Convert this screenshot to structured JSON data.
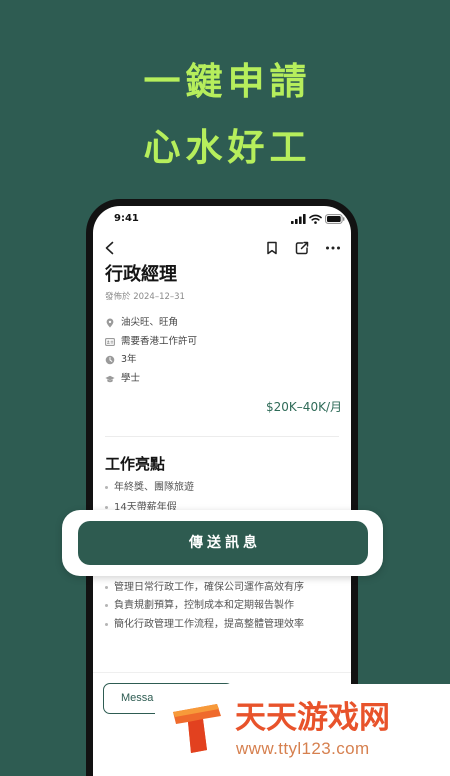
{
  "headline": {
    "line1": "一鍵申請",
    "line2": "心水好工"
  },
  "status_bar": {
    "time": "9:41",
    "icons": [
      "signal-icon",
      "wifi-icon",
      "battery-icon"
    ]
  },
  "nav": {
    "icons": [
      "back-chevron-icon",
      "bookmark-icon",
      "share-icon",
      "more-icon"
    ]
  },
  "job": {
    "title": "行政經理",
    "posted": "發佈於 2024–12–31",
    "details": [
      {
        "icon": "location-pin-icon",
        "text": "油尖旺、旺角"
      },
      {
        "icon": "id-card-icon",
        "text": "需要香港工作許可"
      },
      {
        "icon": "clock-icon",
        "text": "3年"
      },
      {
        "icon": "graduation-cap-icon",
        "text": "學士"
      }
    ],
    "salary": "$20K–40K/月"
  },
  "highlights": {
    "heading": "工作亮點",
    "items": [
      "年終獎、團隊旅遊",
      "14天帶薪年假"
    ]
  },
  "duties": [
    "管理日常行政工作，確保公司運作高效有序",
    "負責規劃預算，控制成本和定期報告製作",
    "簡化行政管理工作流程，提高整體管理效率"
  ],
  "send_button": {
    "label": "傳送訊息"
  },
  "bottom_bar": {
    "message_button": "Messa"
  },
  "watermark": {
    "name": "天天游戏网",
    "url": "www.ttyl123.com"
  },
  "colors": {
    "background": "#2e5c52",
    "headline": "#b6ee5c",
    "primary_button": "#2e5b50",
    "salary": "#2f6b58",
    "watermark_text": "#e8532b"
  }
}
